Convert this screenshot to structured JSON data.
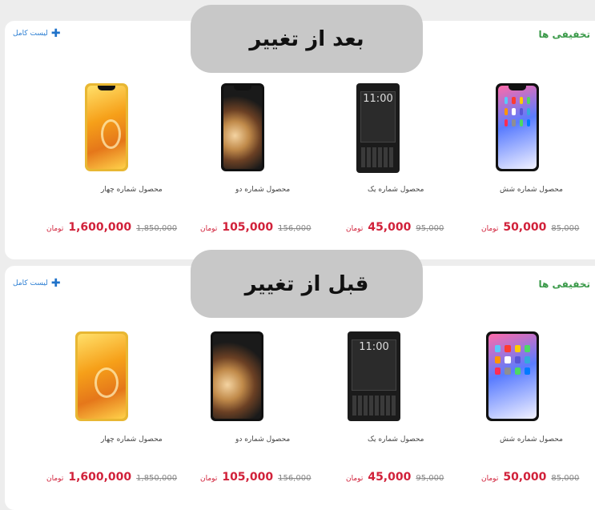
{
  "badges": {
    "after": "بعد از تغییر",
    "before": "قبل از تغییر"
  },
  "section": {
    "title": "تخفیفی ها",
    "full_list": "لیست کامل",
    "plus_icon": "plus-icon"
  },
  "currency": "تومان",
  "products": [
    {
      "name": "محصول شماره شش",
      "old_price": "85,000",
      "new_price": "50,000",
      "phone": "iphone-x"
    },
    {
      "name": "محصول شماره یک",
      "old_price": "95,000",
      "new_price": "45,000",
      "phone": "blackberry-key2"
    },
    {
      "name": "محصول شماره دو",
      "old_price": "156,000",
      "new_price": "105,000",
      "phone": "iphone-xs"
    },
    {
      "name": "محصول شماره چهار",
      "old_price": "1,850,000",
      "new_price": "1,600,000",
      "phone": "iphone-xr"
    }
  ],
  "colors": {
    "accent_green": "#3b9a4a",
    "price_red": "#d1213a",
    "link_blue": "#2d7fd3",
    "badge_gray": "#c8c8c8"
  }
}
